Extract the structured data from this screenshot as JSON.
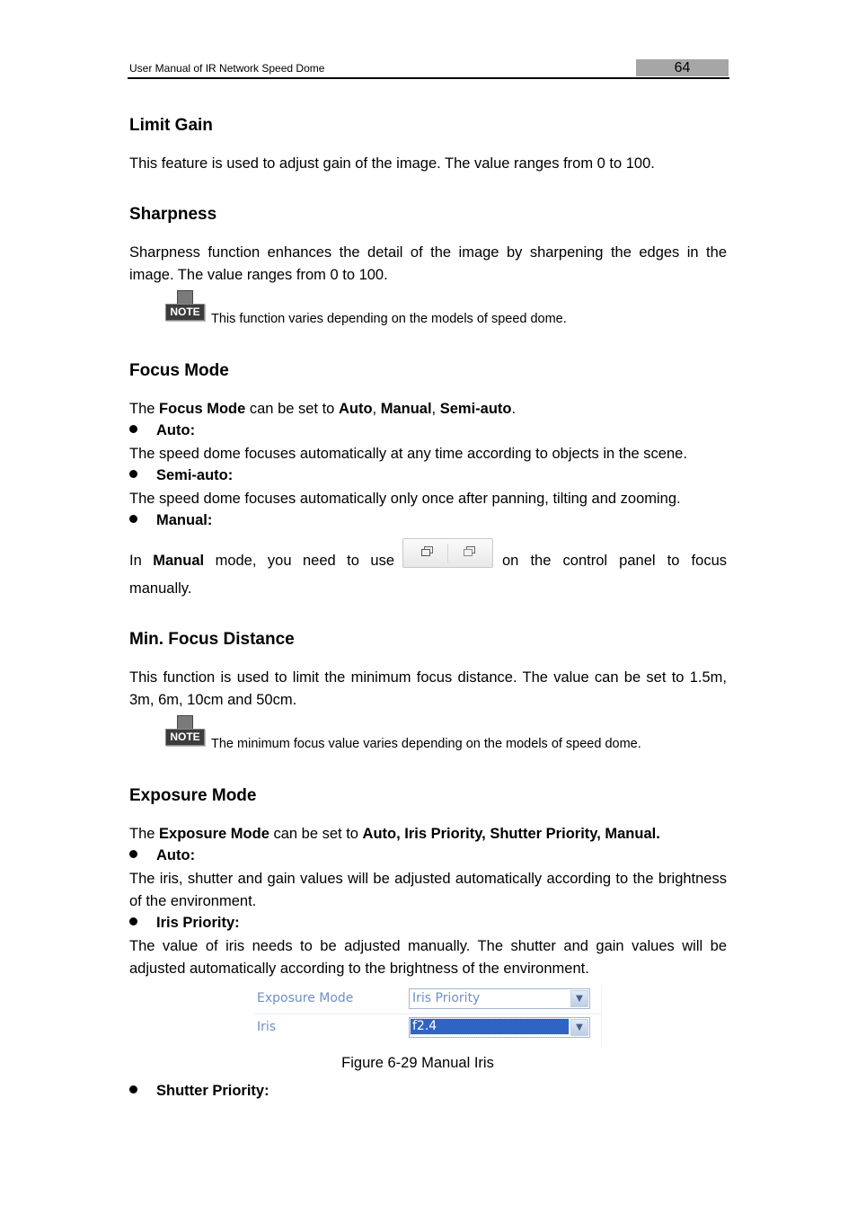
{
  "header": {
    "title": "User Manual of IR Network Speed Dome",
    "page_number": "64"
  },
  "sections": {
    "limit_gain": {
      "heading": "Limit Gain",
      "body": "This feature is used to adjust gain of the image. The value ranges from 0 to 100."
    },
    "sharpness": {
      "heading": "Sharpness",
      "body": "Sharpness function enhances the detail of the image by sharpening the edges in the image. The value ranges from 0 to 100.",
      "note_label": "NOTE",
      "note": "This function varies depending on the models of speed dome."
    },
    "focus_mode": {
      "heading": "Focus Mode",
      "intro_prefix": "The ",
      "intro_bold1": "Focus Mode",
      "intro_mid": " can be set to ",
      "intro_bold2": "Auto",
      "intro_sep1": ", ",
      "intro_bold3": "Manual",
      "intro_sep2": ", ",
      "intro_bold4": "Semi-auto",
      "intro_end": ".",
      "bullets": [
        {
          "label": "Auto:",
          "text": "The speed dome focuses automatically at any time according to objects in the scene."
        },
        {
          "label": "Semi-auto:",
          "text": "The speed dome focuses automatically only once after panning, tilting and zooming."
        },
        {
          "label": "Manual:"
        }
      ],
      "manual_prefix": "In ",
      "manual_bold": "Manual",
      "manual_mid": " mode, you need to use",
      "manual_suffix": "on the control panel to focus",
      "manual_end": "manually.",
      "control_icons": [
        "focus-near-icon",
        "focus-far-icon"
      ]
    },
    "min_focus": {
      "heading": "Min. Focus Distance",
      "body": "This function is used to limit the minimum focus distance. The value can be set to 1.5m, 3m, 6m, 10cm and 50cm.",
      "note_label": "NOTE",
      "note": "The minimum focus value varies depending on the models of speed dome."
    },
    "exposure_mode": {
      "heading": "Exposure Mode",
      "intro_prefix": "The ",
      "intro_bold1": "Exposure Mode",
      "intro_mid": " can be set to ",
      "intro_bold2": "Auto, Iris Priority, Shutter Priority, Manual.",
      "bullets": [
        {
          "label": "Auto:",
          "text": "The iris, shutter and gain values will be adjusted automatically according to the brightness of the environment."
        },
        {
          "label": "Iris Priority:",
          "text": "The value of iris needs to be adjusted manually. The shutter and gain values will be adjusted automatically according to the brightness of the environment."
        },
        {
          "label": "Shutter Priority:"
        }
      ],
      "figure": {
        "rows": [
          {
            "label": "Exposure Mode",
            "value": "Iris Priority"
          },
          {
            "label": "Iris",
            "value": "f2.4"
          }
        ],
        "caption": "Figure 6-29 Manual Iris"
      }
    }
  }
}
